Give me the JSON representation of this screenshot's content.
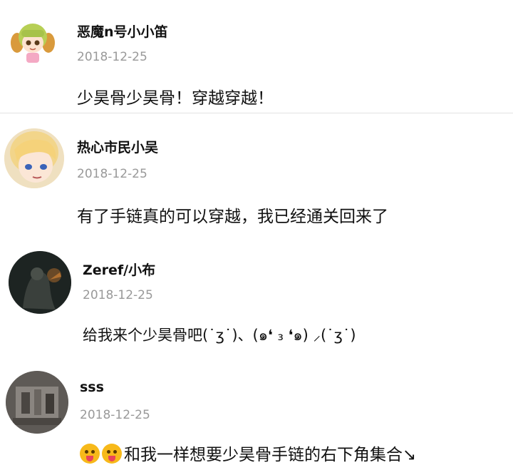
{
  "comments": [
    {
      "user": "恶魔n号小小笛",
      "date": "2018-12-25",
      "text": "少昊骨少昊骨！穿越穿越！",
      "avatar": "anime-girl-green-hair"
    },
    {
      "user": "热心市民小吴",
      "date": "2018-12-25",
      "text": "有了手链真的可以穿越，我已经通关回来了",
      "avatar": "anime-blonde-boy"
    },
    {
      "user": "Zeref/小布",
      "date": "2018-12-25",
      "text": "给我来个少昊骨吧(˙ʒ˙)、(๑❛ ₃ ❛๑) ⸝(˙ʒ˙)",
      "avatar": "dark-armored-figure"
    },
    {
      "user": "sss",
      "date": "2018-12-25",
      "text": "和我一样想要少昊骨手链的右下角集合↘",
      "emoji_prefix": [
        "tongue-out-emoji",
        "tongue-out-emoji"
      ],
      "avatar": "grey-stone-scene"
    }
  ]
}
